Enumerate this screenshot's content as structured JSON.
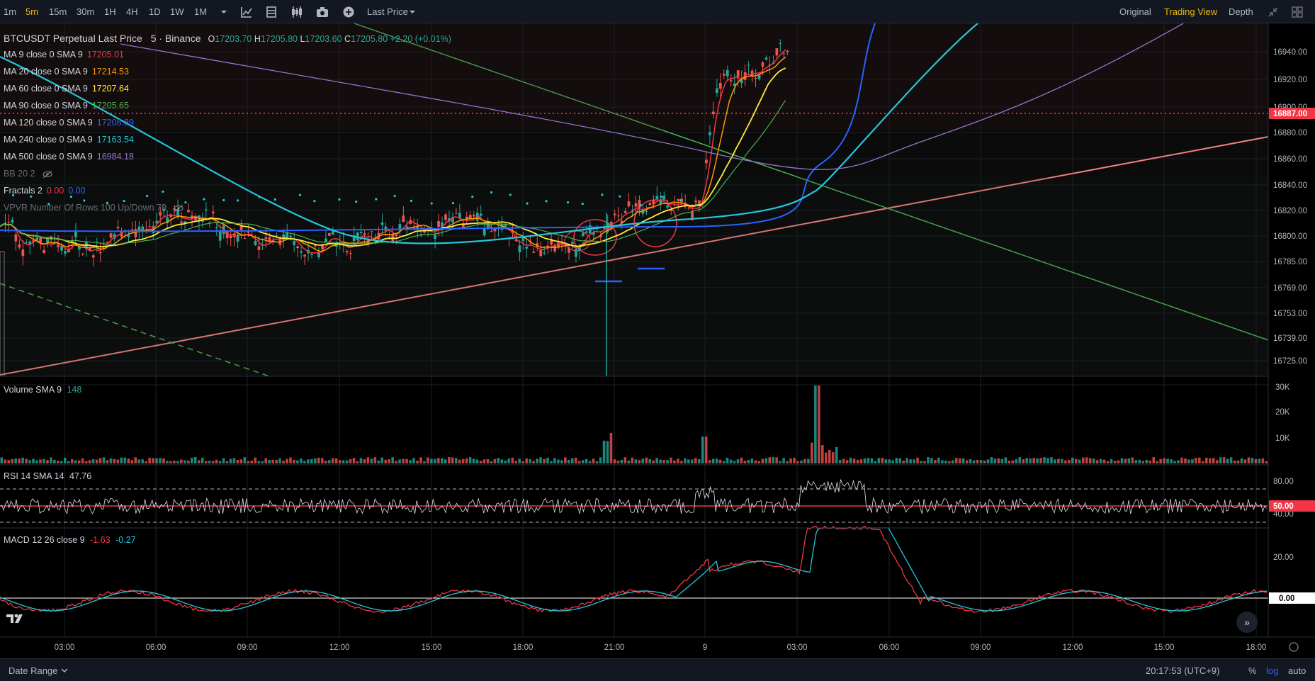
{
  "toolbar": {
    "timeframes": [
      "1m",
      "5m",
      "15m",
      "30m",
      "1H",
      "4H",
      "1D",
      "1W",
      "1M"
    ],
    "active_timeframe": "5m",
    "price_source": "Last Price",
    "views": [
      "Original",
      "Trading View",
      "Depth"
    ],
    "active_view": "Trading View"
  },
  "symbol": {
    "title": "BTCUSDT Perpetual Last Price",
    "interval": "5",
    "exchange": "Binance",
    "o_label": "O",
    "o": "17203.70",
    "h_label": "H",
    "h": "17205.80",
    "l_label": "L",
    "l": "17203.60",
    "c_label": "C",
    "c": "17205.80",
    "change": "+2.20 (+0.01%)"
  },
  "indicators": [
    {
      "label": "MA 9 close 0 SMA 9",
      "value": "17205.01",
      "color": "#f23645"
    },
    {
      "label": "MA 20 close 0 SMA 9",
      "value": "17214.53",
      "color": "#ff9800"
    },
    {
      "label": "MA 60 close 0 SMA 9",
      "value": "17207.64",
      "color": "#ffeb3b"
    },
    {
      "label": "MA 90 close 0 SMA 9",
      "value": "17205.65",
      "color": "#4caf50"
    },
    {
      "label": "MA 120 close 0 SMA 9",
      "value": "17208.89",
      "color": "#2962ff"
    },
    {
      "label": "MA 240 close 0 SMA 9",
      "value": "17163.54",
      "color": "#26c6da"
    },
    {
      "label": "MA 500 close 0 SMA 9",
      "value": "16984.18",
      "color": "#9575cd"
    }
  ],
  "bb": {
    "label": "BB 20 2"
  },
  "fractals": {
    "label": "Fractals 2",
    "value1": "0.00",
    "value2": "0.00"
  },
  "vpvr": {
    "label": "VPVR Number Of Rows 100 Up/Down 70"
  },
  "price_axis": {
    "ticks": [
      "16940.00",
      "16920.00",
      "16900.00",
      "16880.00",
      "16860.00",
      "16840.00",
      "16820.00",
      "16800.00",
      "16785.00",
      "16769.00",
      "16753.00",
      "16739.00",
      "16725.00"
    ],
    "current_price": "16887.00",
    "current_color": "#f23645"
  },
  "volume": {
    "label": "Volume SMA 9",
    "value": "148",
    "ticks": [
      "30K",
      "20K",
      "10K"
    ]
  },
  "rsi": {
    "label": "RSI 14 SMA 14",
    "value": "47.76",
    "ticks": [
      "80.00",
      "40.00"
    ],
    "mid": "50.00"
  },
  "macd": {
    "label": "MACD 12 26 close 9",
    "value1": "-1.63",
    "value2": "-0.27",
    "ticks": [
      "20.00"
    ],
    "zero": "0.00"
  },
  "time_axis": [
    "03:00",
    "06:00",
    "09:00",
    "12:00",
    "15:00",
    "18:00",
    "21:00",
    "9",
    "03:00",
    "06:00",
    "09:00",
    "12:00",
    "15:00",
    "18:00"
  ],
  "bottom": {
    "date_range": "Date Range",
    "clock": "20:17:53 (UTC+9)",
    "percent": "%",
    "log": "log",
    "auto": "auto"
  },
  "colors": {
    "up": "#26a69a",
    "down": "#ef5350",
    "accent": "#f0b90b",
    "log_active": "#2962ff"
  }
}
